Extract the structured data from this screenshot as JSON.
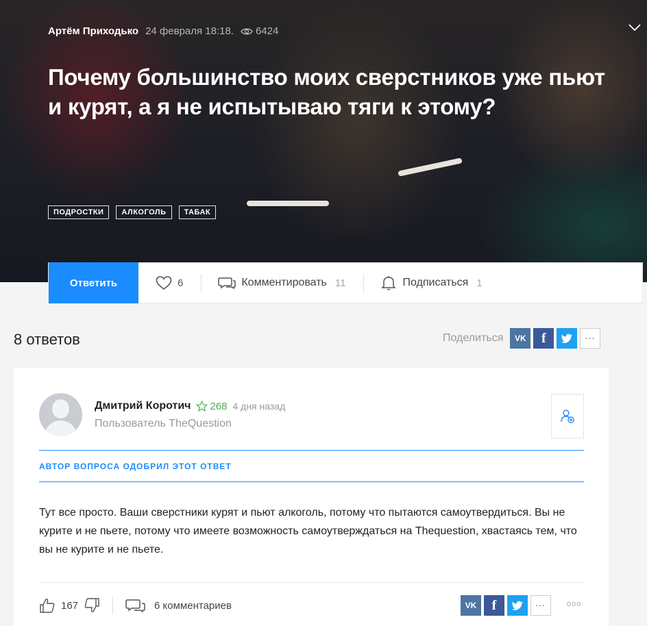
{
  "question": {
    "author": "Артём Приходько",
    "date": "24 февраля 18:18.",
    "views": "6424",
    "title": "Почему большинство моих сверстников уже пьют и курят, а я не испытываю тяги к этому?",
    "tags": [
      "ПОДРОСТКИ",
      "АЛКОГОЛЬ",
      "ТАБАК"
    ]
  },
  "actions": {
    "reply_label": "Ответить",
    "likes": "6",
    "comment_label": "Комментировать",
    "comment_count": "11",
    "subscribe_label": "Подписаться",
    "subscribe_count": "1"
  },
  "answers_header": {
    "count_label": "8 ответов",
    "share_label": "Поделиться",
    "vk": "VK",
    "fb": "f",
    "more": "···"
  },
  "answer": {
    "author_name": "Дмитрий Коротич",
    "rating": "268",
    "time": "4 дня назад",
    "role": "Пользователь TheQuestion",
    "approved_label": "АВТОР ВОПРОСА ОДОБРИЛ ЭТОТ ОТВЕТ",
    "text": "Тут все просто. Ваши сверстники курят и пьют алкоголь, потому что пытаются самоутвердиться. Вы не курите и не пьете, потому что имеете возможность самоутверждаться на Thequestion, хвастаясь тем, что вы не курите и не пьете.",
    "upvotes": "167",
    "comments_label": "6 комментариев",
    "dots": "ooo"
  },
  "icons": {
    "eye": "eye-icon",
    "chevron": "chevron-down-icon",
    "heart": "heart-icon",
    "comment": "comment-icon",
    "bell": "bell-icon",
    "star": "star-icon",
    "follow": "add-user-icon",
    "thumb_up": "thumbs-up-icon",
    "thumb_down": "thumbs-down-icon",
    "twitter": "twitter-icon"
  },
  "colors": {
    "accent": "#1a8cff",
    "rating": "#4caf50",
    "vk": "#4c75a3",
    "facebook": "#3b5998",
    "twitter": "#1da1f2"
  }
}
